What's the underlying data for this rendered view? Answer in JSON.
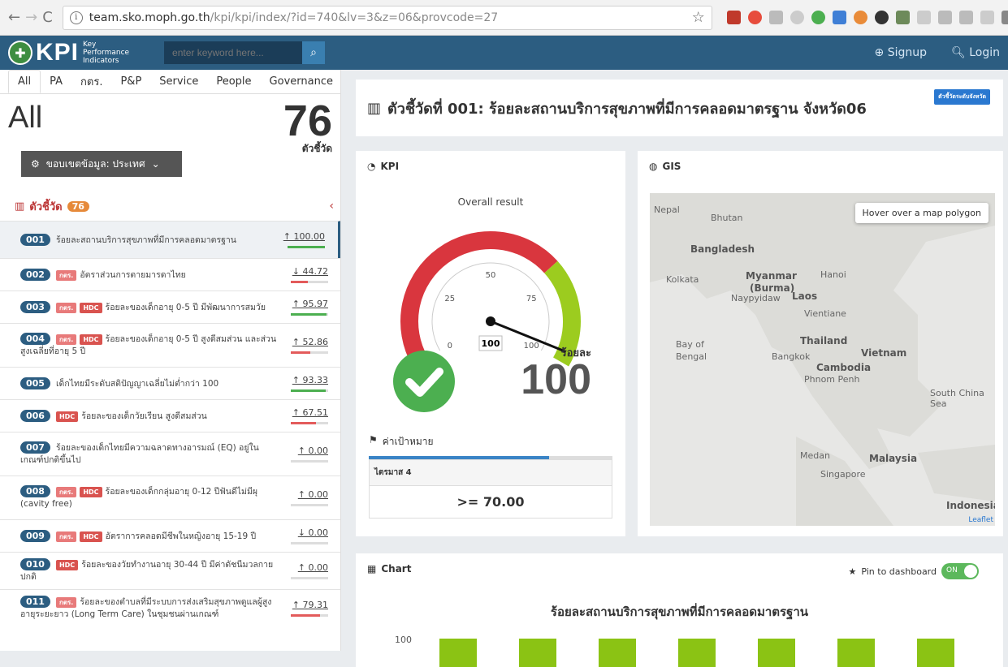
{
  "browser": {
    "url_host": "team.sko.moph.go.th",
    "url_path": "/kpi/kpi/index/?id=740&lv=3&z=06&provcode=27"
  },
  "app": {
    "logo": "KPI",
    "logo_sub": "Key Performance Indicators",
    "search_placeholder": "enter keyword here...",
    "signup": "Signup",
    "login": "Login"
  },
  "tabs": [
    "All",
    "PA",
    "กตร.",
    "P&P",
    "Service",
    "People",
    "Governance"
  ],
  "sidebar": {
    "title": "All",
    "count": "76",
    "count_label": "ตัวชี้วัด",
    "scope_label": "ขอบเขตข้อมูล: ประเทศ",
    "list_title": "ตัวชี้วัด",
    "list_badge": "76"
  },
  "items": [
    {
      "num": "001",
      "tags": [],
      "text": "ร้อยละสถานบริการสุขภาพที่มีการคลอดมาตรฐาน",
      "value": "100.00",
      "dir": "up",
      "fill": 1.0,
      "color": "#4caf50"
    },
    {
      "num": "002",
      "tags": [
        "กตร."
      ],
      "text": "อัตราส่วนการตายมารดาไทย",
      "value": "44.72",
      "dir": "down",
      "fill": 0.45,
      "color": "#e35b5b"
    },
    {
      "num": "003",
      "tags": [
        "กตร.",
        "HDC"
      ],
      "text": "ร้อยละของเด็กอายุ 0-5 ปี มีพัฒนาการสมวัย",
      "value": "95.97",
      "dir": "up",
      "fill": 0.96,
      "color": "#4caf50"
    },
    {
      "num": "004",
      "tags": [
        "กตร.",
        "HDC"
      ],
      "text": "ร้อยละของเด็กอายุ 0-5 ปี สูงดีสมส่วน และส่วนสูงเฉลี่ยที่อายุ 5 ปี",
      "value": "52.86",
      "dir": "up",
      "fill": 0.53,
      "color": "#e35b5b"
    },
    {
      "num": "005",
      "tags": [],
      "text": "เด็กไทยมีระดับสติปัญญาเฉลี่ยไม่ต่ำกว่า 100",
      "value": "93.33",
      "dir": "up",
      "fill": 0.93,
      "color": "#4caf50"
    },
    {
      "num": "006",
      "tags": [
        "HDC"
      ],
      "text": "ร้อยละของเด็กวัยเรียน สูงดีสมส่วน",
      "value": "67.51",
      "dir": "up",
      "fill": 0.68,
      "color": "#e35b5b"
    },
    {
      "num": "007",
      "tags": [],
      "text": "ร้อยละของเด็กไทยมีความฉลาดทางอารมณ์ (EQ) อยู่ในเกณฑ์ปกติขึ้นไป",
      "value": "0.00",
      "dir": "up",
      "fill": 0,
      "color": "#ddd"
    },
    {
      "num": "008",
      "tags": [
        "กตร.",
        "HDC"
      ],
      "text": "ร้อยละของเด็กกลุ่มอายุ 0-12 ปีฟันดีไม่มีผุ (cavity free)",
      "value": "0.00",
      "dir": "up",
      "fill": 0,
      "color": "#ddd"
    },
    {
      "num": "009",
      "tags": [
        "กตร.",
        "HDC"
      ],
      "text": "อัตราการคลอดมีชีพในหญิงอายุ 15-19 ปี",
      "value": "0.00",
      "dir": "down",
      "fill": 0,
      "color": "#ddd"
    },
    {
      "num": "010",
      "tags": [
        "HDC"
      ],
      "text": "ร้อยละของวัยทำงานอายุ 30-44 ปี มีค่าดัชนีมวลกายปกติ",
      "value": "0.00",
      "dir": "up",
      "fill": 0,
      "color": "#ddd"
    },
    {
      "num": "011",
      "tags": [
        "กตร."
      ],
      "text": "ร้อยละของตำบลที่มีระบบการส่งเสริมสุขภาพดูแลผู้สูงอายุระยะยาว (Long Term Care) ในชุมชนผ่านเกณฑ์",
      "value": "79.31",
      "dir": "up",
      "fill": 0.79,
      "color": "#e35b5b"
    }
  ],
  "main": {
    "title": "ตัวชี้วัดที่ 001: ร้อยละสถานบริการสุขภาพที่มีการคลอดมาตรฐาน จังหวัด06",
    "title_btn": "ตัวชี้วัดระดับจังหวัด",
    "kpi_header": "KPI",
    "gauge_title": "Overall result",
    "gauge_ticks": [
      "0",
      "25",
      "50",
      "75",
      "100"
    ],
    "gauge_value": 100,
    "gauge_value_label": "100",
    "unit": "ร้อยละ",
    "result": "100",
    "target_label": "ค่าเป้าหมาย",
    "quarter": "ไตรมาส 4",
    "target_value": ">= 70.00",
    "gis_header": "GIS",
    "hover_hint": "Hover over a map polygon",
    "leaflet": "Leaflet",
    "map_labels": [
      "Nepal",
      "Bhutan",
      "Bangladesh",
      "Kolkata",
      "Myanmar",
      "(Burma)",
      "Naypyidaw",
      "Laos",
      "Hanoi",
      "Vientiane",
      "Bay of",
      "Bengal",
      "Thailand",
      "Bangkok",
      "Vietnam",
      "Cambodia",
      "Phnom Penh",
      "South China Sea",
      "Medan",
      "Malaysia",
      "Singapore",
      "Indonesia"
    ],
    "chart_header": "Chart",
    "pin_label": "Pin to dashboard",
    "toggle": "ON",
    "chart_title": "ร้อยละสถานบริการสุขภาพที่มีการคลอดมาตรฐาน"
  },
  "chart_data": {
    "type": "bar",
    "title": "ร้อยละสถานบริการสุขภาพที่มีการคลอดมาตรฐาน",
    "y_tick_visible": "100"
  }
}
